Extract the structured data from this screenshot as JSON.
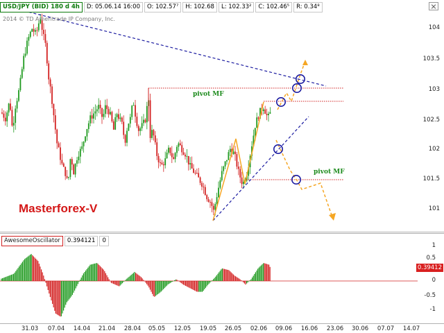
{
  "infobar": {
    "symbol": "USD/JPY (BID) 180 d 4h",
    "date": "D: 05.06.14 16:00",
    "open": "O: 102.57⁷",
    "high": "H: 102.68",
    "low": "L: 102.33²",
    "close": "C: 102.46⁵",
    "range": "R: 0.34⁸"
  },
  "copyright": "2014 © TD Ameritrade IP Company, Inc.",
  "watermark": "Masterforex-V",
  "pivot_label_upper": "pivot MF",
  "pivot_label_lower": "pivot MF",
  "price_axis": [
    "104",
    "103.5",
    "103",
    "102.5",
    "102",
    "101.5",
    "101"
  ],
  "oscillator": {
    "name": "AwesomeOscillator",
    "value": "0.394121",
    "extra": "0",
    "axis": [
      "1",
      "0.5",
      "0",
      "-0.5",
      "-1"
    ],
    "current_value_badge": "0.39412"
  },
  "time_axis": [
    "31.03",
    "07.04",
    "14.04",
    "21.04",
    "28.04",
    "05.05",
    "12.05",
    "19.05",
    "26.05",
    "02.06",
    "09.06",
    "16.06",
    "23.06",
    "30.06",
    "07.07",
    "14.07"
  ],
  "colors": {
    "bull_candle": "#1f9a1f",
    "bear_candle": "#d32020",
    "trendline": "#1a1aa0",
    "projection": "#f5a623",
    "pivot_line": "#d02020"
  }
}
